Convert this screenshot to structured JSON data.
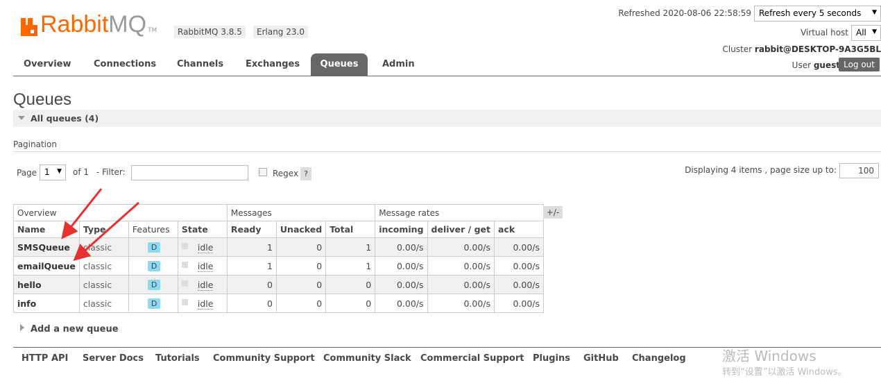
{
  "header": {
    "logo_text_a": "Rabbit",
    "logo_text_b": "MQ",
    "logo_tm": "TM",
    "version_badge": "RabbitMQ 3.8.5",
    "erlang_badge": "Erlang 23.0",
    "refreshed": "Refreshed 2020-08-06 22:58:59",
    "refresh_select": "Refresh every 5 seconds",
    "vhost_label": "Virtual host",
    "vhost_select": "All",
    "cluster_label": "Cluster",
    "cluster_name": "rabbit@DESKTOP-9A3G5BL",
    "user_label": "User",
    "user_name": "guest",
    "logout_label": "Log out",
    "accent_color": "#ff6600"
  },
  "nav": {
    "tabs": [
      "Overview",
      "Connections",
      "Channels",
      "Exchanges",
      "Queues",
      "Admin"
    ],
    "active": "Queues"
  },
  "page": {
    "title": "Queues",
    "section_label": "All queues (4)",
    "pagination_label": "Pagination",
    "page_label": "Page",
    "page_select": "1",
    "of_label": "of 1",
    "filter_label": "- Filter:",
    "filter_value": "",
    "regex_label": "Regex",
    "regex_help": "?",
    "displaying": "Displaying 4 items , page size up to:",
    "page_size": "100",
    "plus_minus": "+/-",
    "add_queue": "Add a new queue"
  },
  "table": {
    "groups": [
      "Overview",
      "Messages",
      "Message rates"
    ],
    "columns": [
      "Name",
      "Type",
      "Features",
      "State",
      "Ready",
      "Unacked",
      "Total",
      "incoming",
      "deliver / get",
      "ack"
    ],
    "rows": [
      {
        "name": "SMSQueue",
        "type": "classic",
        "features": "D",
        "state": "idle",
        "ready": "1",
        "unacked": "0",
        "total": "1",
        "incoming": "0.00/s",
        "deliver_get": "0.00/s",
        "ack": "0.00/s"
      },
      {
        "name": "emailQueue",
        "type": "classic",
        "features": "D",
        "state": "idle",
        "ready": "1",
        "unacked": "0",
        "total": "1",
        "incoming": "0.00/s",
        "deliver_get": "0.00/s",
        "ack": "0.00/s"
      },
      {
        "name": "hello",
        "type": "classic",
        "features": "D",
        "state": "idle",
        "ready": "0",
        "unacked": "0",
        "total": "0",
        "incoming": "0.00/s",
        "deliver_get": "0.00/s",
        "ack": "0.00/s"
      },
      {
        "name": "info",
        "type": "classic",
        "features": "D",
        "state": "idle",
        "ready": "0",
        "unacked": "0",
        "total": "0",
        "incoming": "0.00/s",
        "deliver_get": "0.00/s",
        "ack": "0.00/s"
      }
    ]
  },
  "footer": {
    "links": [
      "HTTP API",
      "Server Docs",
      "Tutorials",
      "Community Support",
      "Community Slack",
      "Commercial Support",
      "Plugins",
      "GitHub",
      "Changelog"
    ]
  },
  "watermark": {
    "line1": "激活 Windows",
    "line2": "转到“设置”以激活 Windows。"
  },
  "annotation_color": "#e8312f"
}
